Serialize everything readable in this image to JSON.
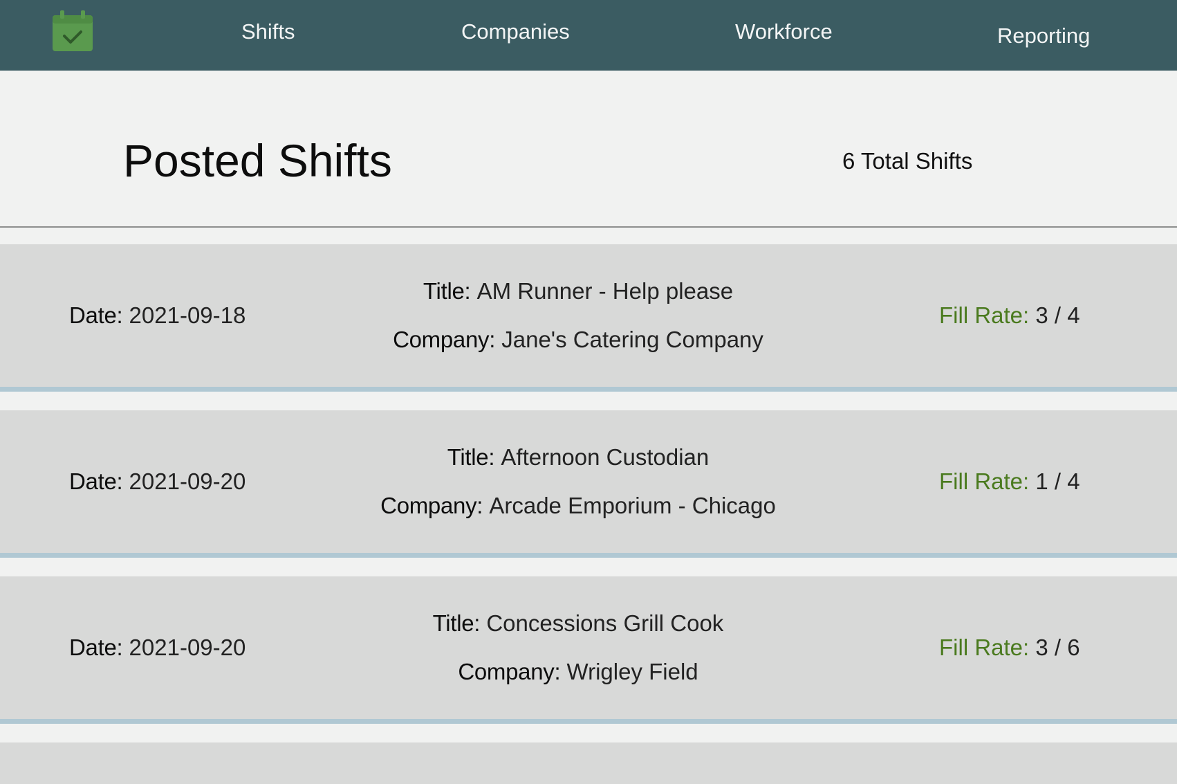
{
  "nav": {
    "logo_icon": "calendar-check-icon",
    "links": [
      "Shifts",
      "Companies",
      "Workforce",
      "Reporting"
    ]
  },
  "header": {
    "title": "Posted Shifts",
    "total": "6 Total Shifts"
  },
  "labels": {
    "date": "Date:",
    "title": "Title:",
    "company": "Company:",
    "fill_rate": "Fill Rate:"
  },
  "shifts": [
    {
      "date": "2021-09-18",
      "title": "AM Runner - Help please",
      "company": "Jane's Catering Company",
      "fill_rate": "3 / 4"
    },
    {
      "date": "2021-09-20",
      "title": "Afternoon Custodian",
      "company": "Arcade Emporium - Chicago",
      "fill_rate": "1 / 4"
    },
    {
      "date": "2021-09-20",
      "title": "Concessions Grill Cook",
      "company": "Wrigley Field",
      "fill_rate": "3 / 6"
    }
  ],
  "colors": {
    "navbar": "#3b5c62",
    "accent_green": "#4a7a1e",
    "logo_green": "#5a9a4e",
    "card_bg": "#d8d9d8",
    "card_border": "#b0c8d3",
    "page_bg": "#f1f2f1"
  }
}
